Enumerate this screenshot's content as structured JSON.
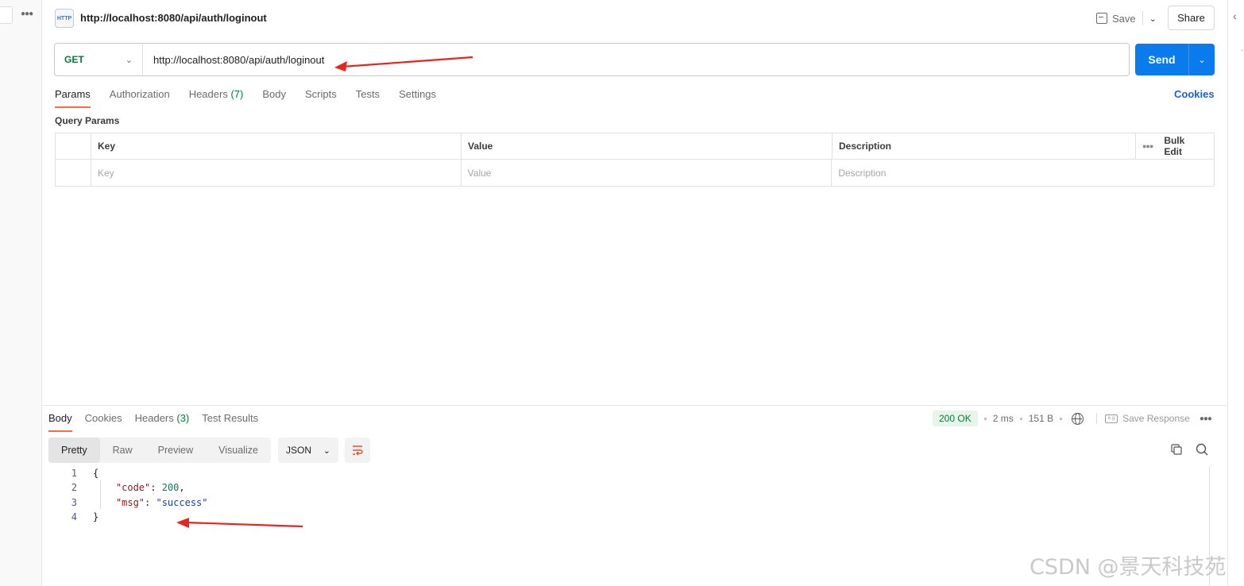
{
  "request": {
    "icon_label": "HTTP",
    "title": "http://localhost:8080/api/auth/loginout",
    "save_label": "Save",
    "share_label": "Share",
    "method": "GET",
    "url": "http://localhost:8080/api/auth/loginout",
    "send_label": "Send",
    "tabs": [
      {
        "label": "Params"
      },
      {
        "label": "Authorization"
      },
      {
        "label": "Headers",
        "count": "(7)"
      },
      {
        "label": "Body"
      },
      {
        "label": "Scripts"
      },
      {
        "label": "Tests"
      },
      {
        "label": "Settings"
      }
    ],
    "cookies_label": "Cookies"
  },
  "params": {
    "title": "Query Params",
    "columns": {
      "key": "Key",
      "value": "Value",
      "description": "Description",
      "bulk_edit": "Bulk Edit"
    },
    "placeholders": {
      "key": "Key",
      "value": "Value",
      "description": "Description"
    }
  },
  "response": {
    "tabs": [
      {
        "label": "Body"
      },
      {
        "label": "Cookies"
      },
      {
        "label": "Headers",
        "count": "(3)"
      },
      {
        "label": "Test Results"
      }
    ],
    "status": "200 OK",
    "time": "2 ms",
    "size": "151 B",
    "save_response_label": "Save Response",
    "views": [
      "Pretty",
      "Raw",
      "Preview",
      "Visualize"
    ],
    "format": "JSON",
    "lines": [
      {
        "num": "1",
        "open": "{"
      },
      {
        "num": "2",
        "key": "\"code\"",
        "sep": ": ",
        "value": "200",
        "trail": ","
      },
      {
        "num": "3",
        "key": "\"msg\"",
        "sep": ": ",
        "value": "\"success\"",
        "trail": ""
      },
      {
        "num": "4",
        "open": "}"
      }
    ]
  },
  "watermark": "CSDN @景天科技苑",
  "colors": {
    "send": "#097bed",
    "method_get": "#0a7a3c",
    "active_tab": "#ff6c37",
    "annotation_arrow": "#e8241c"
  }
}
